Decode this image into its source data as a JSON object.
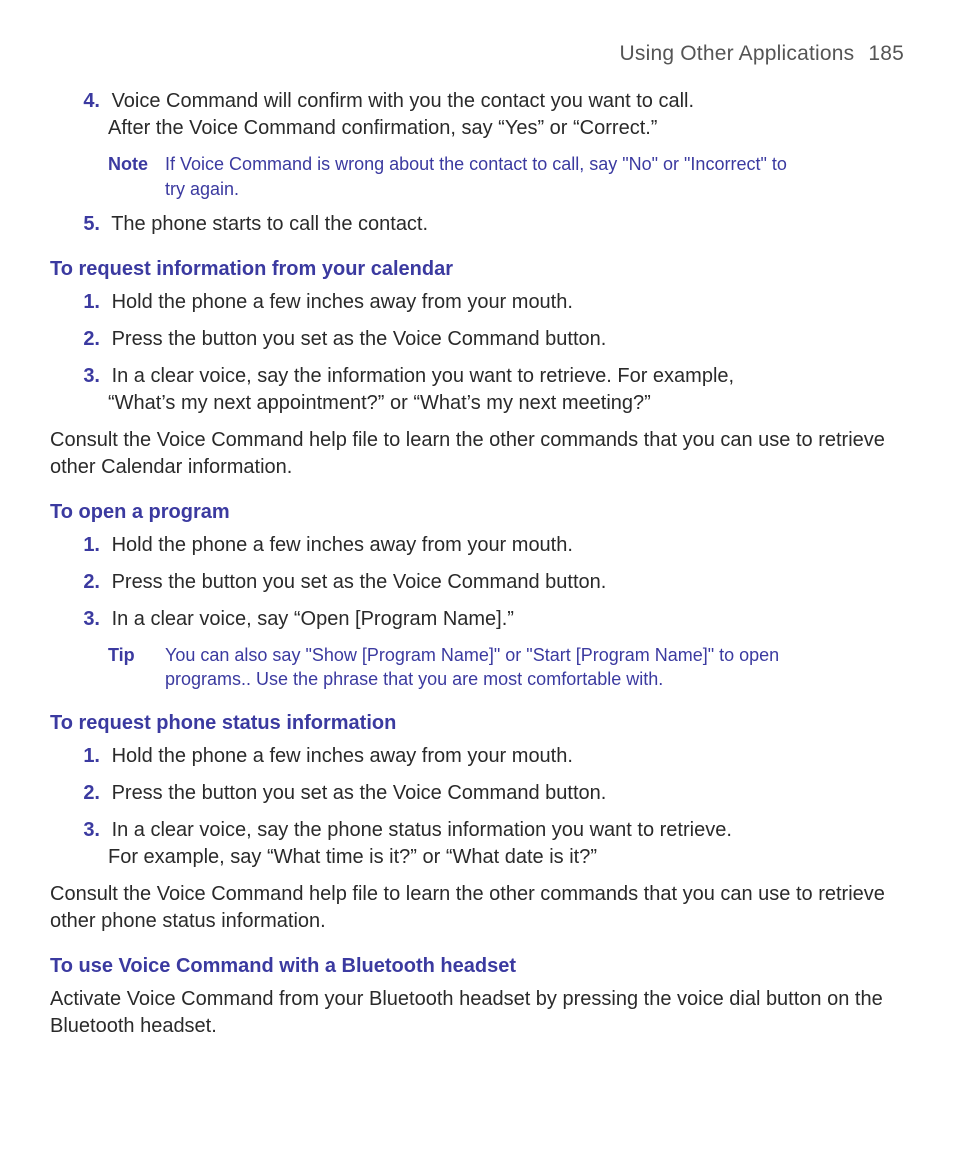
{
  "header": {
    "title": "Using Other Applications",
    "page": "185"
  },
  "items4": {
    "marker": "4.",
    "line1": "Voice Command will confirm with you the contact you want to call.",
    "line2": "After the Voice Command confirmation, say “Yes” or “Correct.”"
  },
  "note1": {
    "label": "Note",
    "text": "If Voice Command is wrong about the contact to call, say \"No\" or \"Incorrect\" to try again."
  },
  "items5": {
    "marker": "5.",
    "text": "The phone starts to call the contact."
  },
  "sec_calendar": {
    "heading": "To request information from your calendar",
    "s1": {
      "marker": "1.",
      "text": "Hold the phone a few inches away from your mouth."
    },
    "s2": {
      "marker": "2.",
      "text": "Press the button you set as the Voice Command button."
    },
    "s3": {
      "marker": "3.",
      "line1": "In a clear voice, say the information you want to retrieve. For example,",
      "line2": "“What’s my next appointment?” or “What’s my next meeting?”"
    },
    "after": "Consult the Voice Command help file to learn the other commands that you can use to retrieve other Calendar information."
  },
  "sec_open": {
    "heading": "To open a program",
    "s1": {
      "marker": "1.",
      "text": "Hold the phone a few inches away from your mouth."
    },
    "s2": {
      "marker": "2.",
      "text": "Press the button you set as the Voice Command button."
    },
    "s3": {
      "marker": "3.",
      "text": "In a clear voice, say “Open [Program Name].”"
    },
    "tip": {
      "label": "Tip",
      "text": "You can also say \"Show [Program Name]\" or \"Start [Program Name]\" to open programs.. Use the phrase that you are most comfortable with."
    }
  },
  "sec_status": {
    "heading": "To request phone status information",
    "s1": {
      "marker": "1.",
      "text": "Hold the phone a few inches away from your mouth."
    },
    "s2": {
      "marker": "2.",
      "text": "Press the button you set as the Voice Command button."
    },
    "s3": {
      "marker": "3.",
      "line1": "In a clear voice, say the phone status information you want to retrieve.",
      "line2": "For example, say “What time is it?” or “What date is it?”"
    },
    "after": "Consult the Voice Command help file to learn the other commands that you can use to retrieve other phone status information."
  },
  "sec_bt": {
    "heading": "To use Voice Command with a Bluetooth headset",
    "text": "Activate Voice Command from your Bluetooth headset by pressing the voice dial button on the Bluetooth headset."
  }
}
